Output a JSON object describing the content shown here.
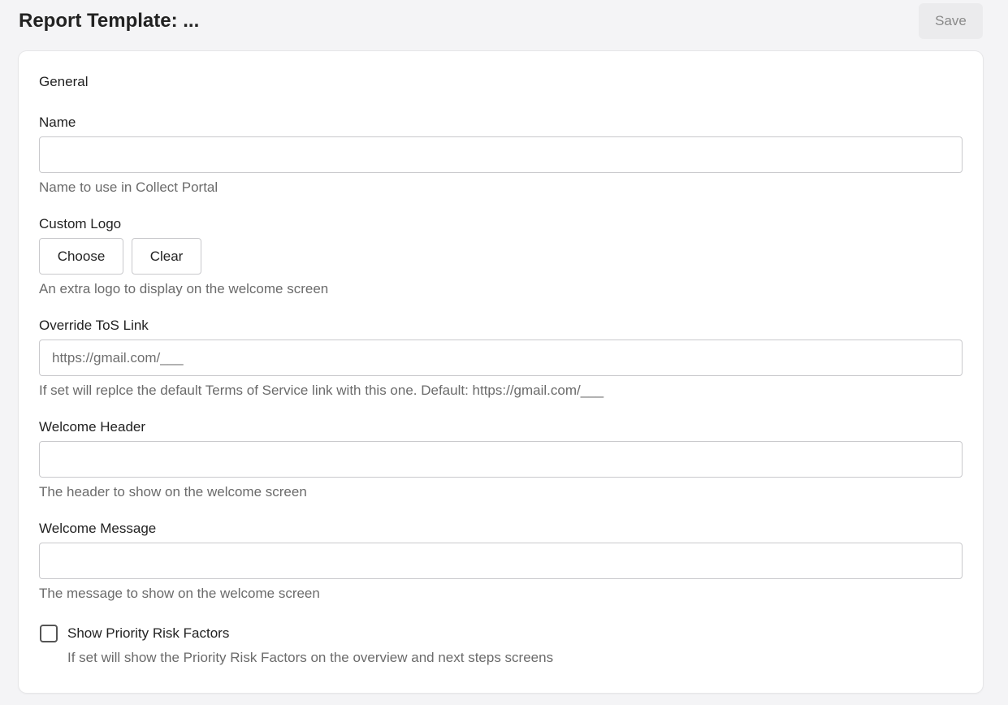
{
  "header": {
    "title": "Report Template: ...",
    "save_label": "Save"
  },
  "general": {
    "section_title": "General",
    "name": {
      "label": "Name",
      "value": "",
      "placeholder": "",
      "help": "Name to use in Collect Portal"
    },
    "custom_logo": {
      "label": "Custom Logo",
      "choose_label": "Choose",
      "clear_label": "Clear",
      "help": "An extra logo to display on the welcome screen"
    },
    "tos_link": {
      "label": "Override ToS Link",
      "value": "",
      "placeholder": "https://gmail.com/___",
      "help": "If set will replce the default Terms of Service link with this one. Default: https://gmail.com/___"
    },
    "welcome_header": {
      "label": "Welcome Header",
      "value": "",
      "placeholder": "",
      "help": "The header to show on the welcome screen"
    },
    "welcome_message": {
      "label": "Welcome Message",
      "value": "",
      "placeholder": "",
      "help": "The message to show on the welcome screen"
    },
    "priority_risk": {
      "label": "Show Priority Risk Factors",
      "checked": false,
      "help": "If set will show the Priority Risk Factors on the overview and next steps screens"
    }
  }
}
